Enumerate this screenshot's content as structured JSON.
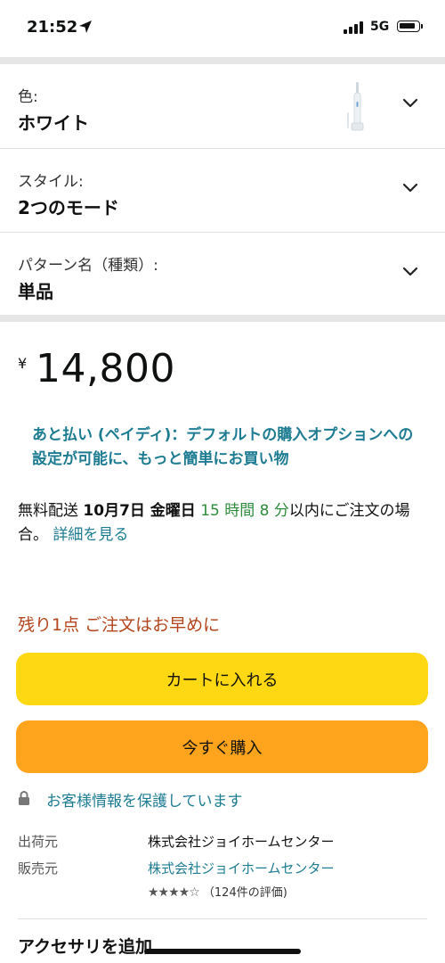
{
  "status_bar": {
    "time": "21:52",
    "network": "5G"
  },
  "variants": [
    {
      "label": "色:",
      "value": "ホワイト",
      "has_thumbnail": true
    },
    {
      "label": "スタイル:",
      "value": "2つのモード",
      "has_thumbnail": false
    },
    {
      "label": "パターン名（種類）:",
      "value": "単品",
      "has_thumbnail": false
    }
  ],
  "price": {
    "currency": "¥",
    "amount": "14,800"
  },
  "promo_text": "あと払い (ペイディ)：デフォルトの購入オプションへの設定が可能に、もっと簡単にお買い物",
  "delivery": {
    "prefix": "無料配送 ",
    "date": "10月7日 金曜日",
    "countdown": " 15 時間 8 分",
    "suffix": "以内にご注文の場合。",
    "details_link": "詳細を見る"
  },
  "stock_notice": "残り1点 ご注文はお早めに",
  "buttons": {
    "add_to_cart": "カートに入れる",
    "buy_now": "今すぐ購入"
  },
  "secure_text": "お客様情報を保護しています",
  "seller_info": {
    "ships_from_label": "出荷元",
    "ships_from_value": "株式会社ジョイホームセンター",
    "sold_by_label": "販売元",
    "sold_by_value": "株式会社ジョイホームセンター"
  },
  "rating": {
    "stars_value": 4.5,
    "stars_glyphs": "★★★★☆",
    "count_text": "（124件の評価)"
  },
  "accessory_heading": "アクセサリを追加",
  "colors": {
    "link": "#1e7c92",
    "cart_button": "#ffd814",
    "buy_button": "#ffa41c",
    "stock_warning": "#b2451c",
    "countdown_green": "#2f8c3c"
  }
}
